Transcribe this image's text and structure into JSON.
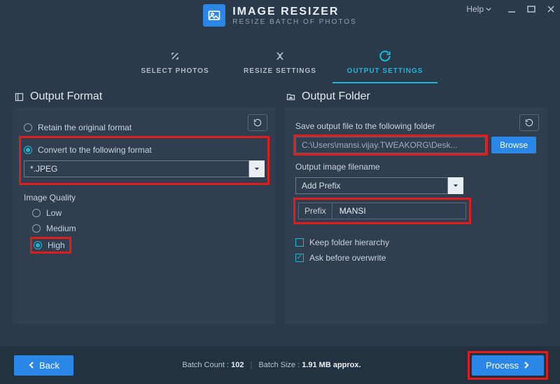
{
  "window": {
    "help_label": "Help"
  },
  "header": {
    "title": "IMAGE RESIZER",
    "subtitle": "RESIZE BATCH OF PHOTOS"
  },
  "tabs": {
    "select": "SELECT PHOTOS",
    "resize": "RESIZE SETTINGS",
    "output": "OUTPUT SETTINGS"
  },
  "format_panel": {
    "title": "Output Format",
    "retain_label": "Retain the original format",
    "convert_label": "Convert to the following format",
    "format_value": "*.JPEG",
    "quality_label": "Image Quality",
    "quality_low": "Low",
    "quality_medium": "Medium",
    "quality_high": "High"
  },
  "folder_panel": {
    "title": "Output Folder",
    "save_label": "Save output file to the following folder",
    "path_value": "C:\\Users\\mansi.vijay.TWEAKORG\\Desk...",
    "browse_label": "Browse",
    "filename_label": "Output image filename",
    "filename_mode": "Add Prefix",
    "prefix_label": "Prefix",
    "prefix_value": "MANSI",
    "keep_hierarchy": "Keep folder hierarchy",
    "ask_overwrite": "Ask before overwrite"
  },
  "footer": {
    "back_label": "Back",
    "batch_count_label": "Batch Count :",
    "batch_count_value": "102",
    "batch_size_label": "Batch Size :",
    "batch_size_value": "1.91 MB approx.",
    "process_label": "Process"
  }
}
